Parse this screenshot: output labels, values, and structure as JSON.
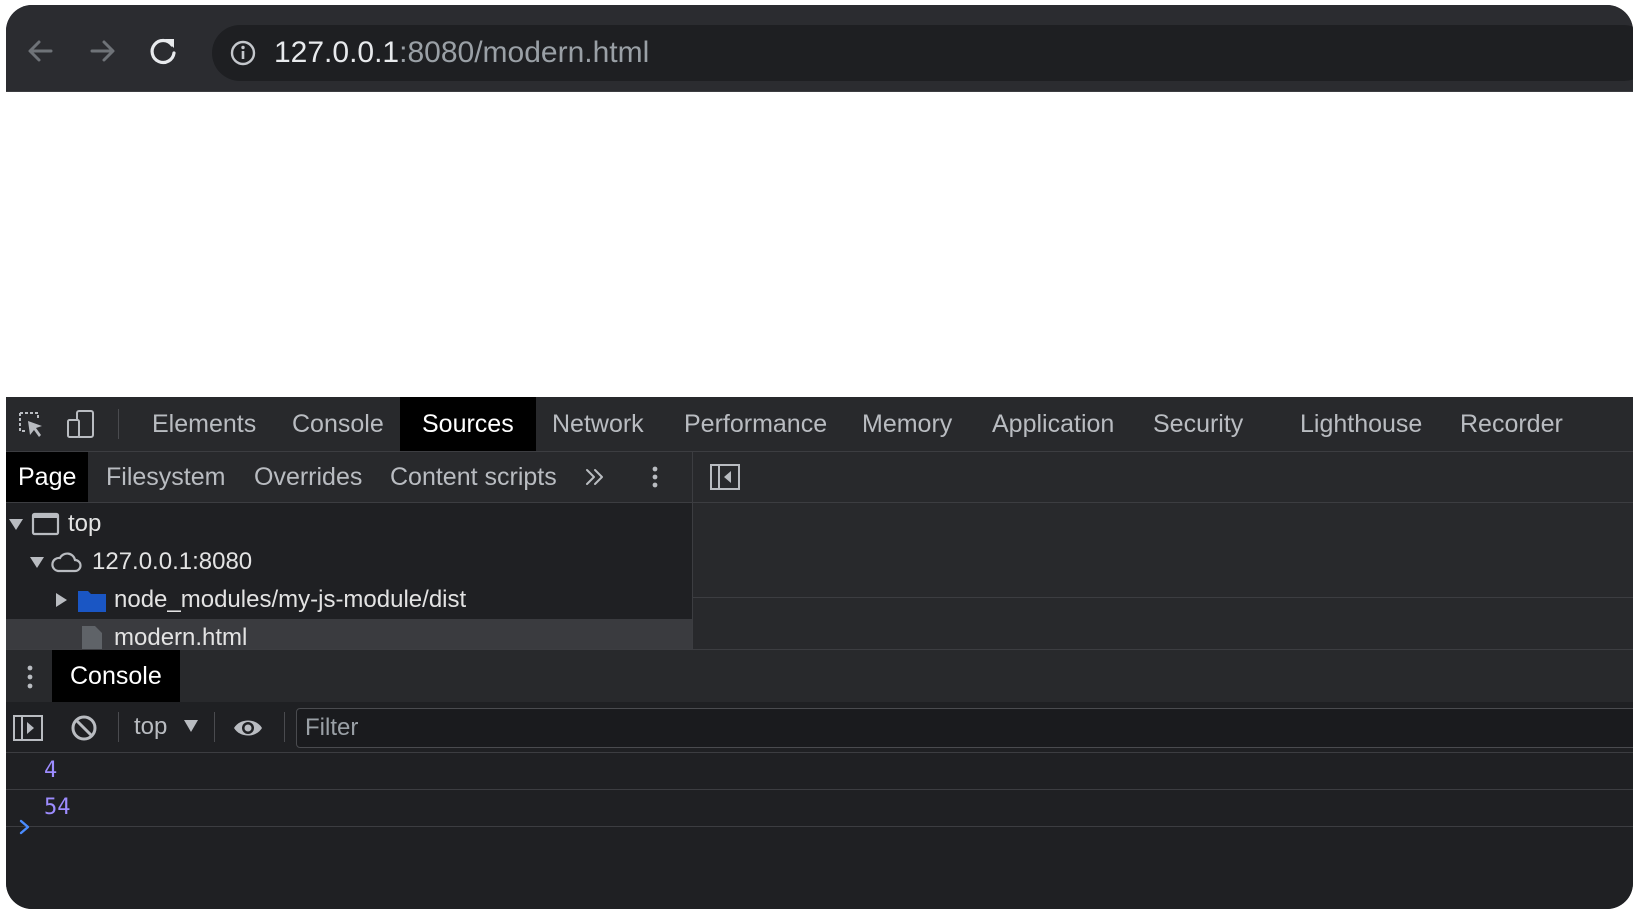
{
  "browser": {
    "url_host": "127.0.0.1",
    "url_rest": ":8080/modern.html"
  },
  "devtools": {
    "tabs": [
      "Elements",
      "Console",
      "Sources",
      "Network",
      "Performance",
      "Memory",
      "Application",
      "Security",
      "Lighthouse",
      "Recorder"
    ],
    "active_tab": "Sources",
    "sources": {
      "nav_tabs": [
        "Page",
        "Filesystem",
        "Overrides",
        "Content scripts"
      ],
      "active_nav_tab": "Page",
      "tree": {
        "top": "top",
        "origin": "127.0.0.1:8080",
        "folder": "node_modules/my-js-module/dist",
        "file": "modern.html"
      }
    },
    "drawer": {
      "tab": "Console",
      "context": "top",
      "filter_placeholder": "Filter",
      "logs": [
        "4",
        "54"
      ]
    }
  },
  "colors": {
    "log_value": "#9d8cff",
    "folder": "#1a56c4",
    "prompt": "#4a8cff"
  }
}
